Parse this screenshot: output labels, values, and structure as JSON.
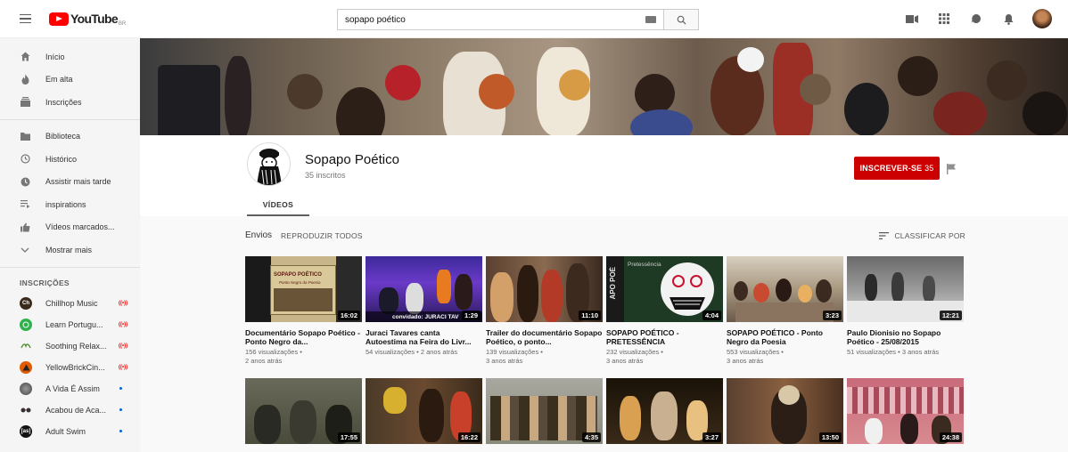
{
  "header": {
    "logo_text": "YouTube",
    "logo_country": "BR",
    "search_value": "sopapo poético"
  },
  "sidebar": {
    "main": [
      {
        "label": "Início",
        "icon": "home-icon"
      },
      {
        "label": "Em alta",
        "icon": "flame-icon"
      },
      {
        "label": "Inscrições",
        "icon": "subscriptions-icon"
      }
    ],
    "library": [
      {
        "label": "Biblioteca",
        "icon": "folder-icon"
      },
      {
        "label": "Histórico",
        "icon": "history-icon"
      },
      {
        "label": "Assistir mais tarde",
        "icon": "clock-icon"
      },
      {
        "label": "inspirations",
        "icon": "playlist-icon"
      },
      {
        "label": "Vídeos marcados...",
        "icon": "thumbs-up-icon"
      },
      {
        "label": "Mostrar mais",
        "icon": "chevron-down-icon"
      }
    ],
    "subs_header": "INSCRIÇÕES",
    "subscriptions": [
      {
        "label": "Chillhop Music",
        "badge": "live",
        "color": "#3a2a1a",
        "initials": "Ch"
      },
      {
        "label": "Learn Portugu...",
        "badge": "live",
        "color": "#2fb24c",
        "initials": ""
      },
      {
        "label": "Soothing Relax...",
        "badge": "live",
        "color": "#f4f4f4",
        "initials": ""
      },
      {
        "label": "YellowBrickCin...",
        "badge": "live",
        "color": "#e05a00",
        "initials": ""
      },
      {
        "label": "A Vida É Assim",
        "badge": "dot",
        "color": "#555555",
        "initials": ""
      },
      {
        "label": "Acabou de Aca...",
        "badge": "dot",
        "color": "#444444",
        "initials": ""
      },
      {
        "label": "Adult Swim",
        "badge": "dot",
        "color": "#111111",
        "initials": "[as]"
      }
    ]
  },
  "channel": {
    "name": "Sopapo Poético",
    "subscribers": "35 inscritos",
    "subscribe_label": "INSCREVER-SE",
    "subscribe_count": "35",
    "tab": "VÍDEOS"
  },
  "section": {
    "title": "Envios",
    "play_all": "REPRODUZIR TODOS",
    "sort": "CLASSIFICAR POR"
  },
  "videos_row1": [
    {
      "title": "Documentário Sopapo Poético - Ponto Negro da...",
      "meta1": "156 visualizações •",
      "meta2": "2 anos atrás",
      "duration": "16:02"
    },
    {
      "title": "Juraci Tavares canta Autoestima na Feira do Livr...",
      "meta1": "54 visualizações • 2 anos atrás",
      "meta2": "",
      "duration": "1:29"
    },
    {
      "title": "Trailer do documentário Sopapo Poético, o ponto...",
      "meta1": "139 visualizações •",
      "meta2": "3 anos atrás",
      "duration": "11:10"
    },
    {
      "title": "SOPAPO POÉTICO - PRETESSÊNCIA",
      "meta1": "232 visualizações •",
      "meta2": "3 anos atrás",
      "duration": "4:04"
    },
    {
      "title": "SOPAPO POÉTICO - Ponto Negro da Poesia",
      "meta1": "553 visualizações •",
      "meta2": "3 anos atrás",
      "duration": "3:23"
    },
    {
      "title": "Paulo Dionisio no Sopapo Poético - 25/08/2015",
      "meta1": "51 visualizações • 3 anos atrás",
      "meta2": "",
      "duration": "12:21"
    }
  ],
  "videos_row2": [
    {
      "duration": "17:55"
    },
    {
      "duration": "16:22"
    },
    {
      "duration": "4:35"
    },
    {
      "duration": "3:27"
    },
    {
      "duration": "13:50"
    },
    {
      "duration": "24:38"
    }
  ],
  "thumb_texts": {
    "t1_a": "SOPAPO POÉTICO",
    "t1_b": "Ponto Negro da Poesia",
    "t2": "convidado: JURACI TAV",
    "t4_a": "Pretessência",
    "t4_b": "APO POÉ"
  },
  "colors": {
    "accent": "#cc0000",
    "brand_red": "#ff0000"
  }
}
